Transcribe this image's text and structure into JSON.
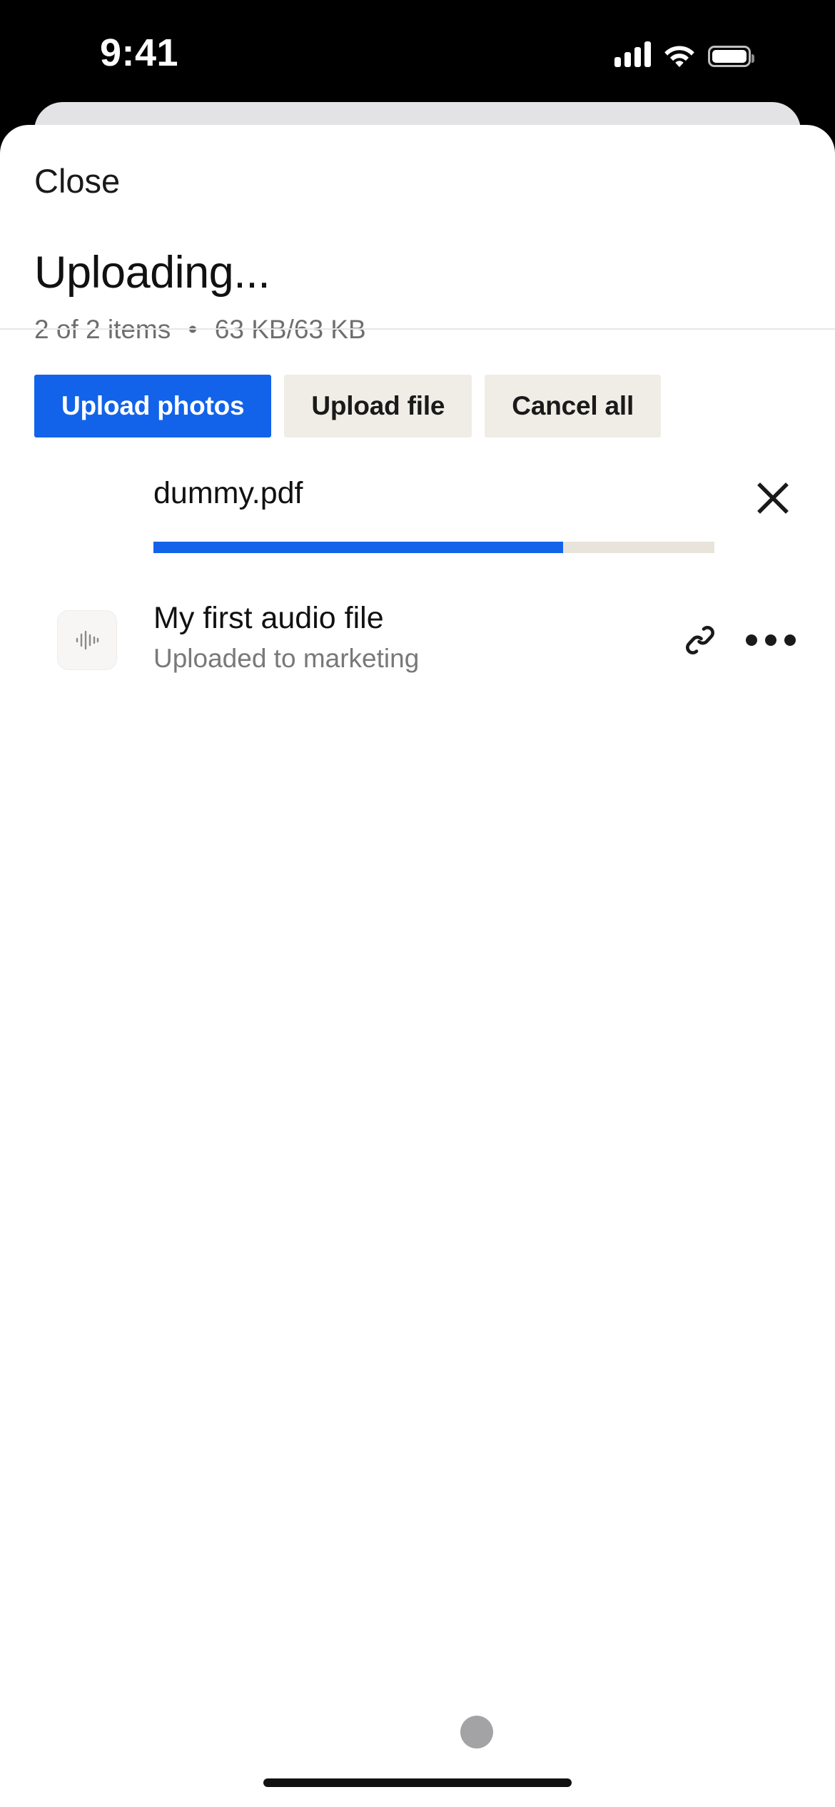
{
  "status_bar": {
    "time": "9:41",
    "cellular_icon": "signal-bars-icon",
    "wifi_icon": "wifi-icon",
    "battery_icon": "battery-icon"
  },
  "sheet": {
    "close_label": "Close",
    "title": "Uploading...",
    "subtitle_items": "2 of 2 items",
    "subtitle_separator": "•",
    "subtitle_size": "63 KB/63 KB",
    "actions": [
      {
        "label": "Upload photos",
        "style": "primary",
        "name": "upload-photos-button"
      },
      {
        "label": "Upload file",
        "style": "secondary",
        "name": "upload-file-button"
      },
      {
        "label": "Cancel all",
        "style": "secondary",
        "name": "cancel-all-button"
      }
    ]
  },
  "uploading_item": {
    "filename": "dummy.pdf",
    "progress_percent": 73,
    "progress_fill_width": "73%",
    "cancel_icon": "close-x-icon"
  },
  "uploaded_items": [
    {
      "title": "My first audio file",
      "subtitle": "Uploaded to marketing",
      "thumb_icon": "audio-waveform-icon",
      "link_icon": "chain-link-icon",
      "more_icon": "ellipsis-icon"
    }
  ],
  "colors": {
    "accent_blue": "#1263EA",
    "secondary_button_bg": "#F0EDE7",
    "progress_track": "#E9E4DB",
    "text_primary": "#111111",
    "text_secondary": "#6E6E6E",
    "cursor": "#A3A3A6"
  }
}
